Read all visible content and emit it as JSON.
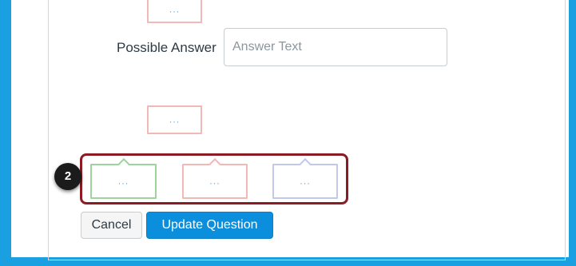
{
  "answer": {
    "label": "Possible Answer",
    "placeholder": "Answer Text",
    "value": ""
  },
  "answer_boxes": {
    "top_dots": "...",
    "middle_dots": "...",
    "option1_dots": "...",
    "option2_dots": "...",
    "option3_dots": "..."
  },
  "step_badge": "2",
  "buttons": {
    "cancel": "Cancel",
    "update": "Update Question"
  },
  "colors": {
    "background": "#1a9fe0",
    "highlight": "#8b1c24",
    "primary_button": "#0b8fdc",
    "box_red": "#f2b8b5",
    "box_green": "#9fd39d",
    "box_blue": "#c2c8ec"
  }
}
